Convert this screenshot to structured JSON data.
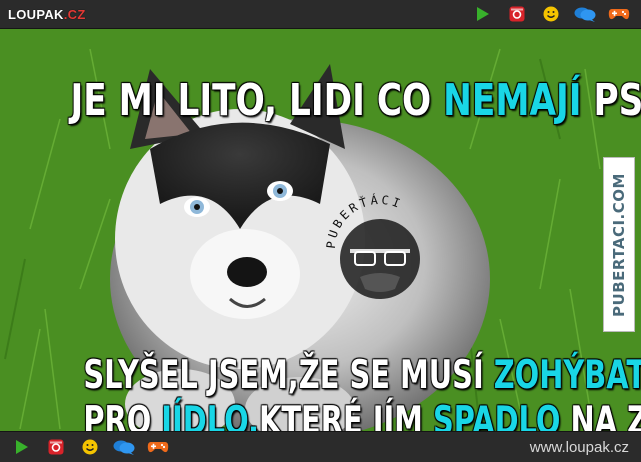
{
  "brand": {
    "name": "LOUPAK",
    "tld": ".CZ"
  },
  "topbar_icons": [
    "play-icon",
    "instagram-icon",
    "smiley-icon",
    "chat-icon",
    "gamepad-icon"
  ],
  "bottombar_icons": [
    "play-icon",
    "instagram-icon",
    "smiley-icon",
    "chat-icon",
    "gamepad-icon"
  ],
  "footer": {
    "url": "www.loupak.cz"
  },
  "meme": {
    "line1_a": "JE MI LITO, LIDI CO ",
    "line1_hl": "NEMAJÍ",
    "line1_b": " PSA",
    "line2_a": "SLYŠEL JSEM,ŽE SE MUSÍ ",
    "line2_hl": "ZOHÝBAT",
    "line3_a": "PRO ",
    "line3_hl1": "JÍDLO,",
    "line3_b": "KTERÉ JÍM ",
    "line3_hl2": "SPADLO",
    "line3_c": " NA ZEM"
  },
  "watermark": {
    "side_text": "PUBERTACI.COM",
    "stamp_text": "PUBERŤÁCI"
  },
  "colors": {
    "highlight": "#19d6e6",
    "play": "#38b12b",
    "instagram": "#d8232a",
    "smiley": "#f5c400",
    "chat": "#1f7fd6",
    "gamepad": "#f06a1a",
    "tld": "#e53935"
  }
}
